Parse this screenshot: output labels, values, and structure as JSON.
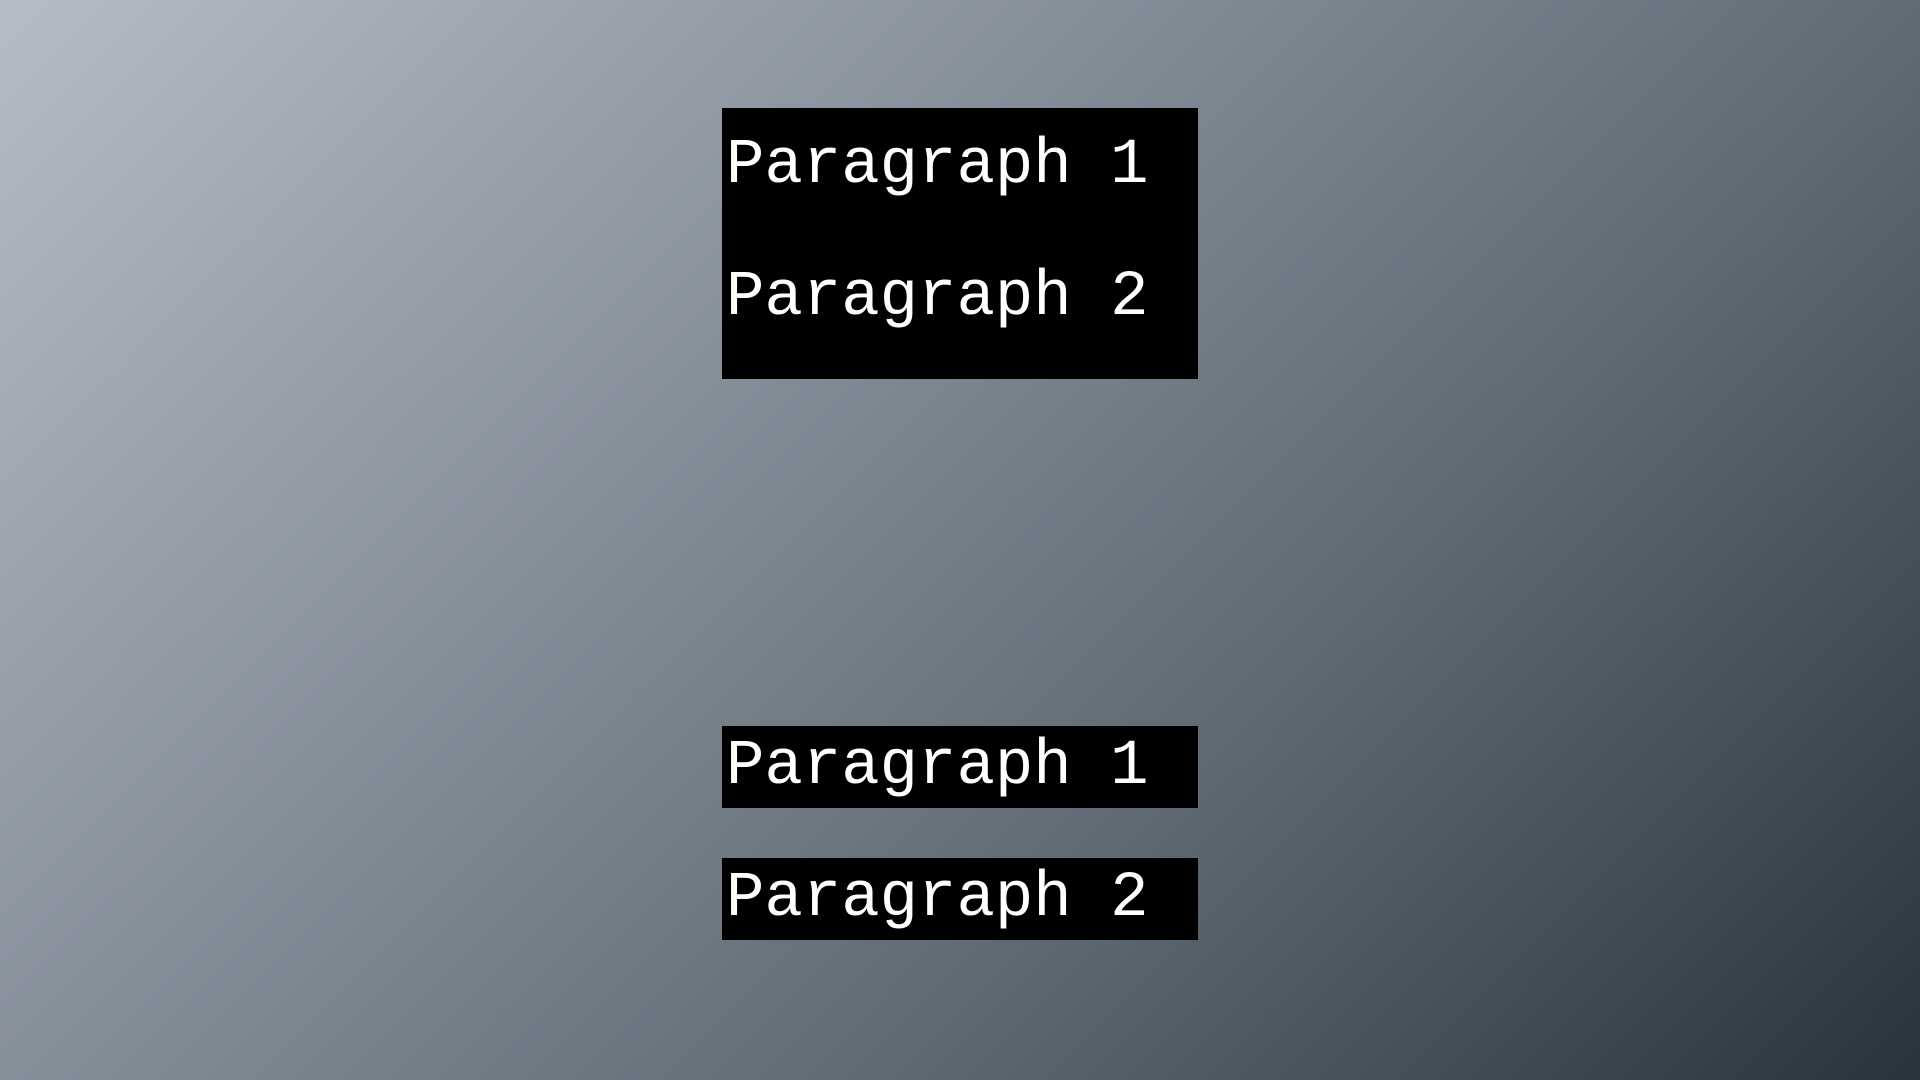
{
  "top_group": {
    "paragraph_1": "Paragraph 1",
    "paragraph_2": "Paragraph 2"
  },
  "bottom_group": {
    "paragraph_1": "Paragraph 1",
    "paragraph_2": "Paragraph 2"
  },
  "colors": {
    "block_background": "#000000",
    "text": "#ffffff",
    "page_gradient_start": "#b5bcc7",
    "page_gradient_end": "#27343d"
  }
}
